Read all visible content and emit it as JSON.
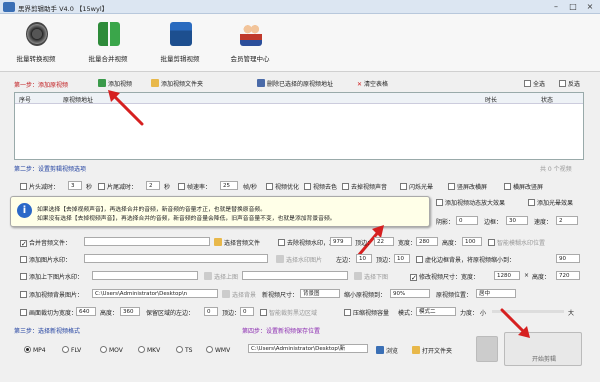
{
  "window": {
    "title": "黑界剪辑助手 V4.0 【15wyl】"
  },
  "toolbar": {
    "items": [
      {
        "label": "批量转换视频",
        "icon": "film-reel-icon"
      },
      {
        "label": "批量合并视频",
        "icon": "merge-buildings-icon"
      },
      {
        "label": "批量剪辑视频",
        "icon": "clapper-icon"
      },
      {
        "label": "会员管理中心",
        "icon": "members-icon"
      }
    ]
  },
  "step1": {
    "label": "第一步：添加原视频",
    "add_video": "添加视频",
    "add_folder": "添加视频文件夹",
    "delete_selected": "删除已选择的原视频地址",
    "clear_table": "清空表格",
    "select_all": "全选",
    "invert": "反选"
  },
  "table": {
    "col_no": "序号",
    "col_path": "原视频地址",
    "col_duration": "时长",
    "col_status": "状态",
    "count": "共 0 个视频"
  },
  "step2": {
    "label": "第二步：设置剪辑视频选项"
  },
  "row1": {
    "head_cut": "片头减时：",
    "head_val": "3",
    "sec1": "秒",
    "tail_cut": "片尾减时：",
    "tail_val": "2",
    "sec2": "秒",
    "framerate": "帧速率：",
    "framerate_val": "25",
    "fps": "帧/秒",
    "optimize": "视频优化",
    "mirror": "视频去色",
    "remove_audio": "去掉视频声音",
    "flash": "闪烁光晕",
    "vertical_flip": "竖屏改横屏",
    "horizontal_flip": "横屏改竖屏"
  },
  "tooltip": {
    "line1": "如果选择【去掉视频声音】，再选择合并的音频，新音频的音量才正，也就是替换原音频。",
    "line2": "如果没有选择【去掉视频声音】，再选择合并的音频，新音频的音量会降低，旧声音音量不变，也就是添加背景音频。"
  },
  "row2_right": {
    "shadow": "阴影：",
    "shadow_val": "0",
    "zoom_in": "添加视频动态放大效果",
    "zoom_out": "添加光晕效果",
    "border": "边框：",
    "border_val": "30",
    "speed": "速度：",
    "speed_val": "2"
  },
  "row3": {
    "merge_audio": "合并音频文件：",
    "choose_audio": "选择音频文件",
    "watermark": "去除视频水印，左边：",
    "wm_left": "979",
    "top": "顶边：",
    "wm_top": "22",
    "width": "宽度：",
    "wm_w": "280",
    "height": "高度：",
    "wm_h": "100",
    "smart_blur": "智能模糊水印位置"
  },
  "row4": {
    "add_image_wm": "添加图片水印：",
    "choose_image": "选择水印图片",
    "left": "左边：",
    "left_val": "10",
    "top": "顶边：",
    "top_val": "10",
    "blur_bg": "虚化边框背景，将原视频缩小到：",
    "blur_val": "90"
  },
  "row5": {
    "add_head_tail": "添加上下图片水印：",
    "upper_img": "选择上图",
    "lower_img": "选择下图",
    "resize": "修改视频尺寸：宽度：",
    "resize_w": "1280",
    "x": "×",
    "hh": "高度：",
    "resize_h": "720"
  },
  "row6": {
    "add_bg": "添加视频背景图片：",
    "bg_path": "C:\\Users\\Administrator\\Desktop\\n",
    "select_bg": "选择背景",
    "video_size": "新视频尺寸：",
    "size_opt": "背景图",
    "shrink": "缩小原视频到：",
    "shrink_val": "90%",
    "position": "原视频位置：",
    "pos_opt": "居中"
  },
  "row7": {
    "crop": "画面裁切为宽度：",
    "crop_w": "640",
    "ch": "高度：",
    "crop_h": "360",
    "keep_left": "保留区域的左边：",
    "kl_val": "0",
    "kt": "顶边：",
    "kt_val": "0",
    "smart_crop": "智能裁剪黑边区域",
    "compress": "压缩视频容量",
    "mode": "模式：",
    "mode_opt": "模式二",
    "force": "力度：",
    "small": "小",
    "big": "大"
  },
  "step3": {
    "label": "第三步：选择新视频格式",
    "formats": [
      "MP4",
      "FLV",
      "MOV",
      "MKV",
      "TS",
      "WMV"
    ]
  },
  "step4": {
    "label": "第四步：设置新视频保存位置",
    "path": "C:\\Users\\Administrator\\Desktop\\新",
    "browse": "浏览",
    "open_folder": "打开文件夹"
  },
  "actions": {
    "start": "开始剪辑"
  }
}
